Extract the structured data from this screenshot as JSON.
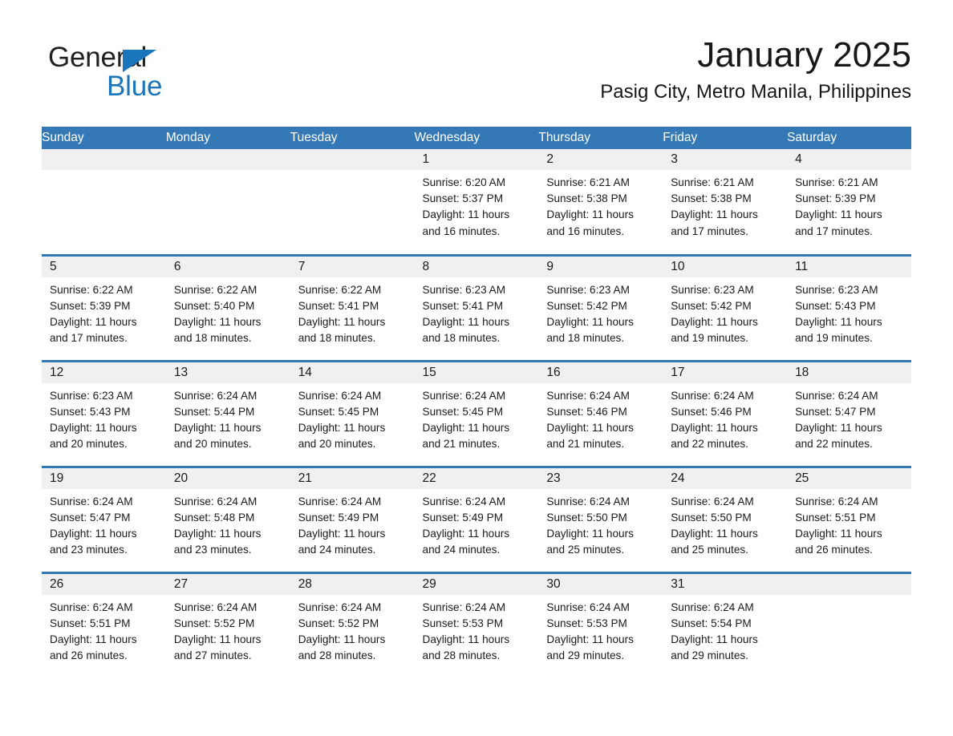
{
  "brand": {
    "name_part1": "General",
    "name_part2": "Blue",
    "triangle_color": "#1b75bb"
  },
  "header": {
    "month_title": "January 2025",
    "location": "Pasig City, Metro Manila, Philippines"
  },
  "theme": {
    "header_blue": "#3478b5",
    "daynum_band": "#f0f0f0",
    "text": "#1a1a1a"
  },
  "weekday_headers": [
    "Sunday",
    "Monday",
    "Tuesday",
    "Wednesday",
    "Thursday",
    "Friday",
    "Saturday"
  ],
  "weeks": [
    [
      {
        "day": "",
        "sunrise": "",
        "sunset": "",
        "daylight_line1": "",
        "daylight_line2": ""
      },
      {
        "day": "",
        "sunrise": "",
        "sunset": "",
        "daylight_line1": "",
        "daylight_line2": ""
      },
      {
        "day": "",
        "sunrise": "",
        "sunset": "",
        "daylight_line1": "",
        "daylight_line2": ""
      },
      {
        "day": "1",
        "sunrise": "Sunrise: 6:20 AM",
        "sunset": "Sunset: 5:37 PM",
        "daylight_line1": "Daylight: 11 hours",
        "daylight_line2": "and 16 minutes."
      },
      {
        "day": "2",
        "sunrise": "Sunrise: 6:21 AM",
        "sunset": "Sunset: 5:38 PM",
        "daylight_line1": "Daylight: 11 hours",
        "daylight_line2": "and 16 minutes."
      },
      {
        "day": "3",
        "sunrise": "Sunrise: 6:21 AM",
        "sunset": "Sunset: 5:38 PM",
        "daylight_line1": "Daylight: 11 hours",
        "daylight_line2": "and 17 minutes."
      },
      {
        "day": "4",
        "sunrise": "Sunrise: 6:21 AM",
        "sunset": "Sunset: 5:39 PM",
        "daylight_line1": "Daylight: 11 hours",
        "daylight_line2": "and 17 minutes."
      }
    ],
    [
      {
        "day": "5",
        "sunrise": "Sunrise: 6:22 AM",
        "sunset": "Sunset: 5:39 PM",
        "daylight_line1": "Daylight: 11 hours",
        "daylight_line2": "and 17 minutes."
      },
      {
        "day": "6",
        "sunrise": "Sunrise: 6:22 AM",
        "sunset": "Sunset: 5:40 PM",
        "daylight_line1": "Daylight: 11 hours",
        "daylight_line2": "and 18 minutes."
      },
      {
        "day": "7",
        "sunrise": "Sunrise: 6:22 AM",
        "sunset": "Sunset: 5:41 PM",
        "daylight_line1": "Daylight: 11 hours",
        "daylight_line2": "and 18 minutes."
      },
      {
        "day": "8",
        "sunrise": "Sunrise: 6:23 AM",
        "sunset": "Sunset: 5:41 PM",
        "daylight_line1": "Daylight: 11 hours",
        "daylight_line2": "and 18 minutes."
      },
      {
        "day": "9",
        "sunrise": "Sunrise: 6:23 AM",
        "sunset": "Sunset: 5:42 PM",
        "daylight_line1": "Daylight: 11 hours",
        "daylight_line2": "and 18 minutes."
      },
      {
        "day": "10",
        "sunrise": "Sunrise: 6:23 AM",
        "sunset": "Sunset: 5:42 PM",
        "daylight_line1": "Daylight: 11 hours",
        "daylight_line2": "and 19 minutes."
      },
      {
        "day": "11",
        "sunrise": "Sunrise: 6:23 AM",
        "sunset": "Sunset: 5:43 PM",
        "daylight_line1": "Daylight: 11 hours",
        "daylight_line2": "and 19 minutes."
      }
    ],
    [
      {
        "day": "12",
        "sunrise": "Sunrise: 6:23 AM",
        "sunset": "Sunset: 5:43 PM",
        "daylight_line1": "Daylight: 11 hours",
        "daylight_line2": "and 20 minutes."
      },
      {
        "day": "13",
        "sunrise": "Sunrise: 6:24 AM",
        "sunset": "Sunset: 5:44 PM",
        "daylight_line1": "Daylight: 11 hours",
        "daylight_line2": "and 20 minutes."
      },
      {
        "day": "14",
        "sunrise": "Sunrise: 6:24 AM",
        "sunset": "Sunset: 5:45 PM",
        "daylight_line1": "Daylight: 11 hours",
        "daylight_line2": "and 20 minutes."
      },
      {
        "day": "15",
        "sunrise": "Sunrise: 6:24 AM",
        "sunset": "Sunset: 5:45 PM",
        "daylight_line1": "Daylight: 11 hours",
        "daylight_line2": "and 21 minutes."
      },
      {
        "day": "16",
        "sunrise": "Sunrise: 6:24 AM",
        "sunset": "Sunset: 5:46 PM",
        "daylight_line1": "Daylight: 11 hours",
        "daylight_line2": "and 21 minutes."
      },
      {
        "day": "17",
        "sunrise": "Sunrise: 6:24 AM",
        "sunset": "Sunset: 5:46 PM",
        "daylight_line1": "Daylight: 11 hours",
        "daylight_line2": "and 22 minutes."
      },
      {
        "day": "18",
        "sunrise": "Sunrise: 6:24 AM",
        "sunset": "Sunset: 5:47 PM",
        "daylight_line1": "Daylight: 11 hours",
        "daylight_line2": "and 22 minutes."
      }
    ],
    [
      {
        "day": "19",
        "sunrise": "Sunrise: 6:24 AM",
        "sunset": "Sunset: 5:47 PM",
        "daylight_line1": "Daylight: 11 hours",
        "daylight_line2": "and 23 minutes."
      },
      {
        "day": "20",
        "sunrise": "Sunrise: 6:24 AM",
        "sunset": "Sunset: 5:48 PM",
        "daylight_line1": "Daylight: 11 hours",
        "daylight_line2": "and 23 minutes."
      },
      {
        "day": "21",
        "sunrise": "Sunrise: 6:24 AM",
        "sunset": "Sunset: 5:49 PM",
        "daylight_line1": "Daylight: 11 hours",
        "daylight_line2": "and 24 minutes."
      },
      {
        "day": "22",
        "sunrise": "Sunrise: 6:24 AM",
        "sunset": "Sunset: 5:49 PM",
        "daylight_line1": "Daylight: 11 hours",
        "daylight_line2": "and 24 minutes."
      },
      {
        "day": "23",
        "sunrise": "Sunrise: 6:24 AM",
        "sunset": "Sunset: 5:50 PM",
        "daylight_line1": "Daylight: 11 hours",
        "daylight_line2": "and 25 minutes."
      },
      {
        "day": "24",
        "sunrise": "Sunrise: 6:24 AM",
        "sunset": "Sunset: 5:50 PM",
        "daylight_line1": "Daylight: 11 hours",
        "daylight_line2": "and 25 minutes."
      },
      {
        "day": "25",
        "sunrise": "Sunrise: 6:24 AM",
        "sunset": "Sunset: 5:51 PM",
        "daylight_line1": "Daylight: 11 hours",
        "daylight_line2": "and 26 minutes."
      }
    ],
    [
      {
        "day": "26",
        "sunrise": "Sunrise: 6:24 AM",
        "sunset": "Sunset: 5:51 PM",
        "daylight_line1": "Daylight: 11 hours",
        "daylight_line2": "and 26 minutes."
      },
      {
        "day": "27",
        "sunrise": "Sunrise: 6:24 AM",
        "sunset": "Sunset: 5:52 PM",
        "daylight_line1": "Daylight: 11 hours",
        "daylight_line2": "and 27 minutes."
      },
      {
        "day": "28",
        "sunrise": "Sunrise: 6:24 AM",
        "sunset": "Sunset: 5:52 PM",
        "daylight_line1": "Daylight: 11 hours",
        "daylight_line2": "and 28 minutes."
      },
      {
        "day": "29",
        "sunrise": "Sunrise: 6:24 AM",
        "sunset": "Sunset: 5:53 PM",
        "daylight_line1": "Daylight: 11 hours",
        "daylight_line2": "and 28 minutes."
      },
      {
        "day": "30",
        "sunrise": "Sunrise: 6:24 AM",
        "sunset": "Sunset: 5:53 PM",
        "daylight_line1": "Daylight: 11 hours",
        "daylight_line2": "and 29 minutes."
      },
      {
        "day": "31",
        "sunrise": "Sunrise: 6:24 AM",
        "sunset": "Sunset: 5:54 PM",
        "daylight_line1": "Daylight: 11 hours",
        "daylight_line2": "and 29 minutes."
      },
      {
        "day": "",
        "sunrise": "",
        "sunset": "",
        "daylight_line1": "",
        "daylight_line2": ""
      }
    ]
  ]
}
